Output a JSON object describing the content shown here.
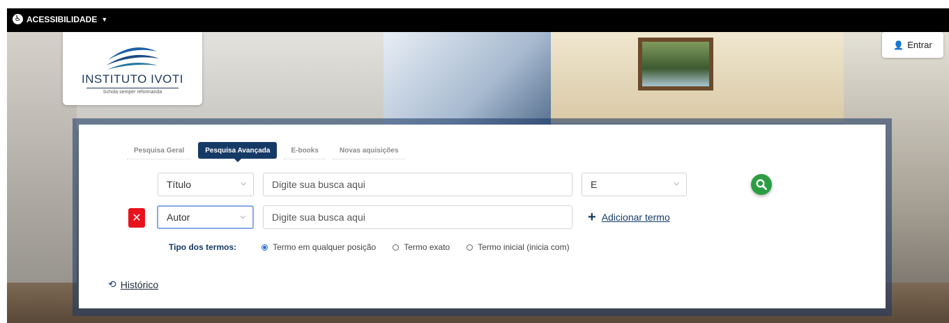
{
  "accessibility": {
    "label": "ACESSIBILIDADE",
    "icon": "accessibility-icon"
  },
  "logo": {
    "title": "INSTITUTO IVOTI",
    "subtitle": "Schola semper reformanda"
  },
  "login": {
    "label": "Entrar",
    "icon": "user-lock-icon"
  },
  "tabs": [
    {
      "label": "Pesquisa Geral",
      "active": false
    },
    {
      "label": "Pesquisa Avançada",
      "active": true
    },
    {
      "label": "E-books",
      "active": false
    },
    {
      "label": "Novas aquisições",
      "active": false
    }
  ],
  "row1": {
    "field": "Título",
    "placeholder": "Digite sua busca aqui",
    "operator": "E"
  },
  "row2": {
    "field": "Autor",
    "placeholder": "Digite sua busca aqui"
  },
  "add_term": {
    "label": "Adicionar termo"
  },
  "term_types": {
    "label": "Tipo dos termos:",
    "options": [
      {
        "label": "Termo em qualquer posição",
        "selected": true
      },
      {
        "label": "Termo exato",
        "selected": false
      },
      {
        "label": "Termo inicial (inicia com)",
        "selected": false
      }
    ]
  },
  "history": {
    "label": "Histórico"
  },
  "colors": {
    "brand": "#163a66",
    "search": "#2c9d43",
    "remove": "#e8121c"
  }
}
